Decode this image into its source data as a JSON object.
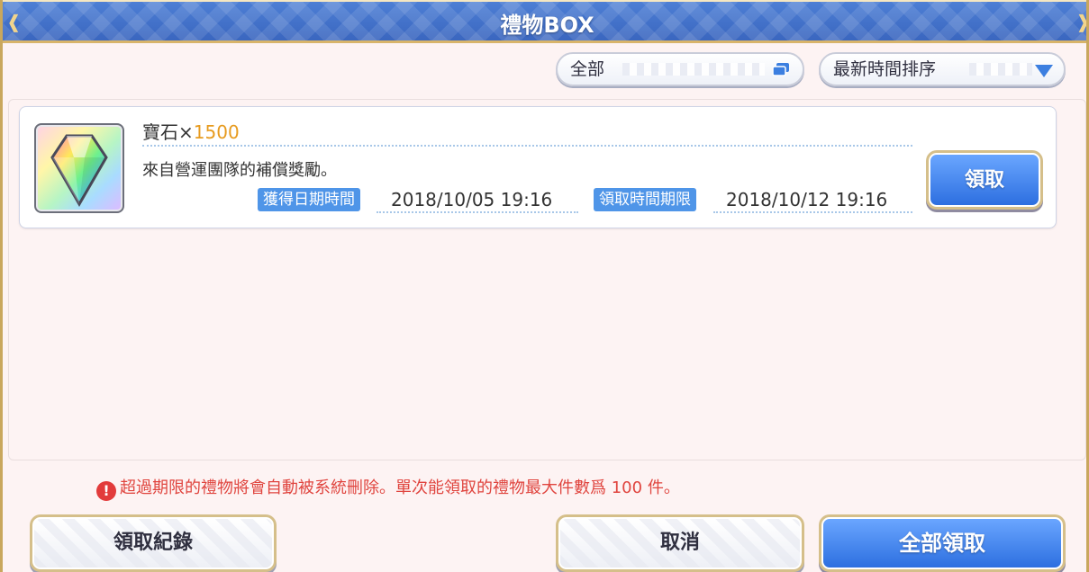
{
  "window": {
    "title": "禮物BOX"
  },
  "filters": {
    "category_label": "全部",
    "sort_label": "最新時間排序"
  },
  "gift_item": {
    "name": "寶石×",
    "quantity": "1500",
    "description": "來自營運團隊的補償獎勵。",
    "received_tag": "獲得日期時間",
    "received_date": "2018/10/05 19:16",
    "deadline_tag": "領取時間期限",
    "deadline_date": "2018/10/12 19:16",
    "claim_label": "領取",
    "icon": "rainbow-gem-icon"
  },
  "notice": {
    "text": "超過期限的禮物將會自動被系統刪除。單次能領取的禮物最大件數爲",
    "max_count": "100",
    "suffix": "件。",
    "icon": "exclamation-icon"
  },
  "footer": {
    "history_label": "領取紀錄",
    "cancel_label": "取消",
    "claim_all_label": "全部領取"
  },
  "colors": {
    "title_bar": "#3a66bf",
    "accent_blue": "#2d6fe0",
    "quantity": "#e79b1f",
    "warning": "#e0453f",
    "gold_border": "#d5bf8a"
  }
}
